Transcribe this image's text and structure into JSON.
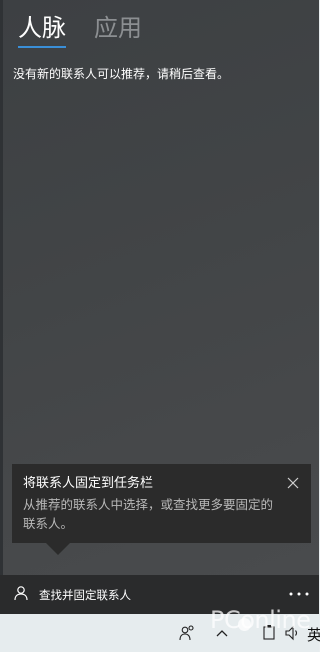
{
  "tabs": [
    {
      "label": "人脉",
      "active": true
    },
    {
      "label": "应用",
      "active": false
    }
  ],
  "notice": "没有新的联系人可以推荐，请稍后查看。",
  "tip": {
    "title": "将联系人固定到任务栏",
    "body": "从推荐的联系人中选择，或查找更多要固定的联系人。",
    "close_icon": "close-icon"
  },
  "bottom_bar": {
    "find_label": "查找并固定联系人",
    "find_icon": "person-icon",
    "more_icon": "more-dots-icon"
  },
  "taskbar": {
    "people_icon": "people-icon",
    "chevron_icon": "chevron-up-icon",
    "battery_icon": "battery-icon",
    "volume_icon": "volume-icon",
    "ime_label": "英"
  },
  "watermark": {
    "text": "PConline"
  },
  "colors": {
    "panel_bg": "#414446",
    "accent": "#3a8fd8",
    "tip_bg": "#2b2b2b",
    "bottom_bar_bg": "#2a2b2c",
    "taskbar_bg": "#e6ecee"
  }
}
